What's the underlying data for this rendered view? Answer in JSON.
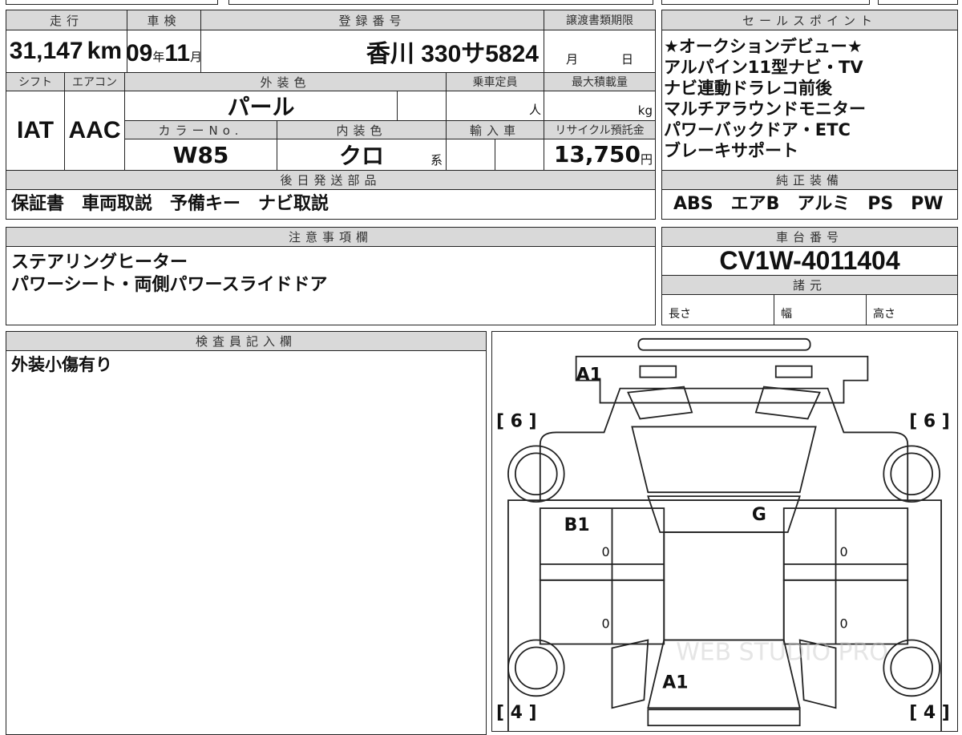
{
  "main_table": {
    "mileage": {
      "label": "走行",
      "value": "31,147",
      "unit": "km"
    },
    "inspection": {
      "label": "車検",
      "year": "09",
      "year_unit": "年",
      "month": "11",
      "month_unit": "月"
    },
    "registration": {
      "label": "登録番号",
      "value": "香川 330サ5824"
    },
    "transfer_deadline": {
      "label": "譲渡書類期限",
      "month_unit": "月",
      "day_unit": "日"
    },
    "shift": {
      "label": "シフト",
      "value": "IAT"
    },
    "aircon": {
      "label": "エアコン",
      "value": "AAC"
    },
    "exterior_color": {
      "label": "外装色",
      "value": "パール"
    },
    "capacity": {
      "label": "乗車定員",
      "unit": "人"
    },
    "max_load": {
      "label": "最大積載量",
      "unit": "kg"
    },
    "color_no": {
      "label": "カラーNo.",
      "value": "W85"
    },
    "interior_color": {
      "label": "内装色",
      "value": "クロ",
      "suffix": "系"
    },
    "imported": {
      "label": "輸入車"
    },
    "recycle_fee": {
      "label": "リサイクル預託金",
      "value": "13,750",
      "unit": "円"
    },
    "later_parts": {
      "label": "後日発送部品",
      "value": "保証書　車両取説　予備キー　ナビ取説"
    }
  },
  "sales_points": {
    "label": "セールスポイント",
    "lines": [
      "★オークションデビュー★",
      "アルパイン11型ナビ・TV",
      "ナビ連動ドラレコ前後",
      "マルチアラウンドモニター",
      "パワーバックドア・ETC",
      "ブレーキサポート"
    ]
  },
  "standard_equipment": {
    "label": "純正装備",
    "value": "ABS　エアB　アルミ　PS　PW"
  },
  "notes": {
    "label": "注意事項欄",
    "lines": [
      "ステアリングヒーター",
      "パワーシート・両側パワースライドドア"
    ]
  },
  "chassis": {
    "label": "車台番号",
    "value": "CV1W-4011404"
  },
  "specs": {
    "label": "諸元",
    "length": "長さ",
    "width": "幅",
    "height": "高さ"
  },
  "inspector": {
    "label": "検査員記入欄",
    "value": "外装小傷有り"
  },
  "diagram": {
    "front_bumper": "A1",
    "hood": "G",
    "left_front_door": "B1",
    "zeros": [
      "0",
      "0",
      "0",
      "0"
    ],
    "rear_bumper": "A1",
    "tire_front_left": "[ 6 ]",
    "tire_front_right": "[ 6 ]",
    "tire_rear_left": "[ 4 ]",
    "tire_rear_right": "[ 4 ]",
    "watermark": "WEB STUDIO PRO"
  }
}
